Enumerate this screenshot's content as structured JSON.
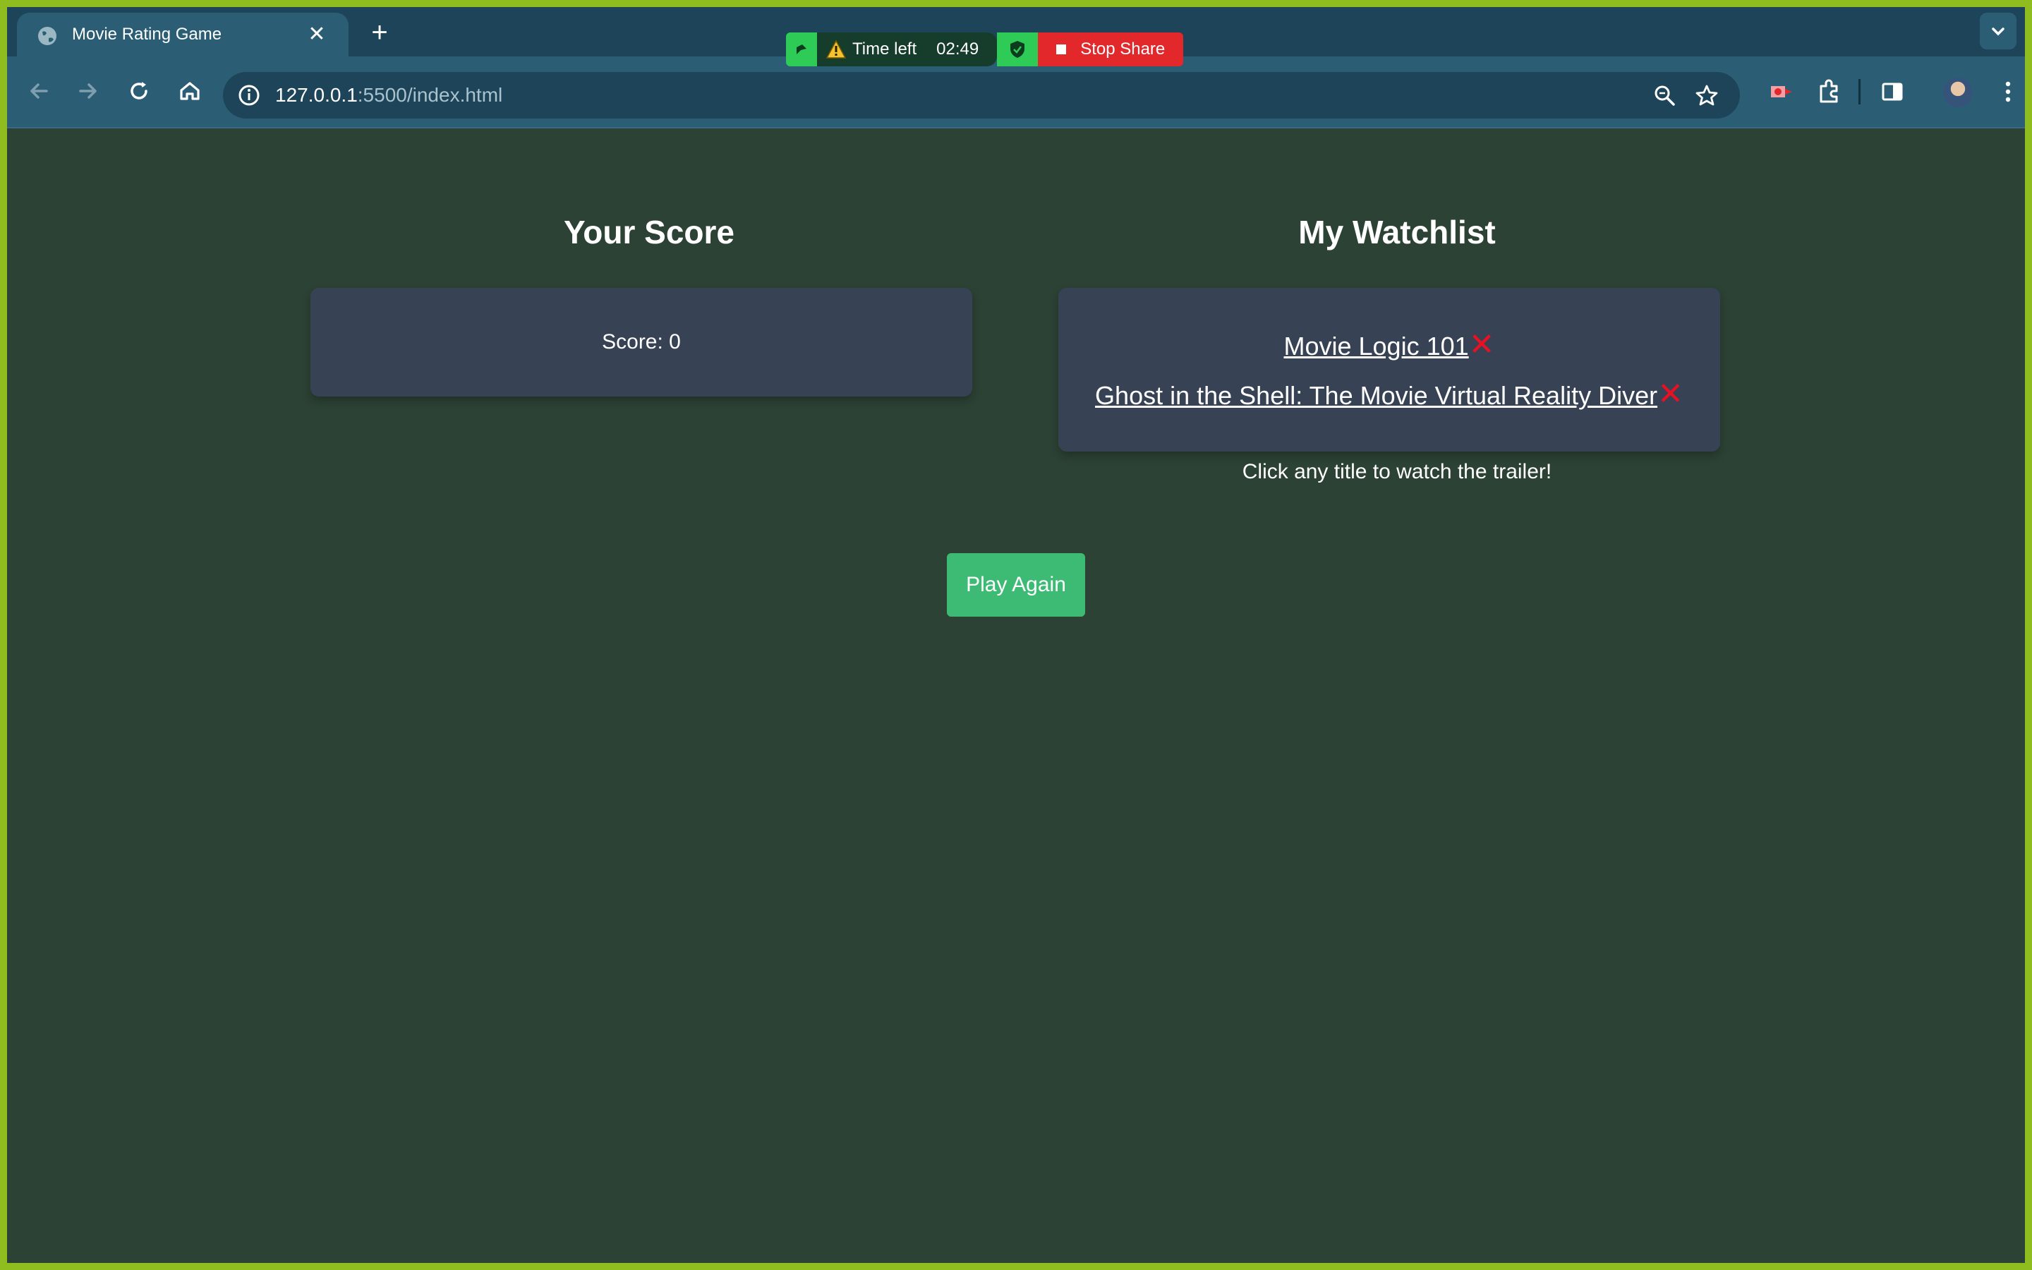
{
  "browser": {
    "tab_title": "Movie Rating Game",
    "url_host": "127.0.0.1",
    "url_rest": ":5500/index.html",
    "accent_tabstrip": "#1d4458",
    "accent_toolbar": "#2b5e75"
  },
  "share_bar": {
    "time_label": "Time left",
    "time_value": "02:49",
    "stop_label": "Stop Share",
    "icons": [
      "drag-grip-icon",
      "warning-icon",
      "shield-icon",
      "stop-icon"
    ]
  },
  "page": {
    "background": "#2c4234",
    "score_section": {
      "heading": "Your Score",
      "score_text": "Score: 0"
    },
    "watchlist_section": {
      "heading": "My Watchlist",
      "items": [
        {
          "title": "Movie Logic 101",
          "remove_glyph": "✕"
        },
        {
          "title": "Ghost in the Shell: The Movie Virtual Reality Diver",
          "remove_glyph": "✕"
        }
      ],
      "hint": "Click any title to watch the trailer!"
    },
    "play_again_label": "Play Again",
    "button_color": "#3dba74"
  }
}
